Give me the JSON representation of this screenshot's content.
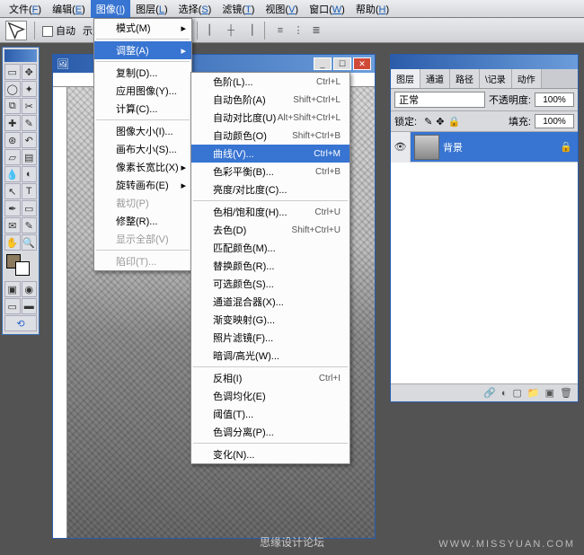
{
  "menubar": {
    "items": [
      {
        "label": "文件",
        "hot": "F"
      },
      {
        "label": "编辑",
        "hot": "E"
      },
      {
        "label": "图像",
        "hot": "I"
      },
      {
        "label": "图层",
        "hot": "L"
      },
      {
        "label": "选择",
        "hot": "S"
      },
      {
        "label": "滤镜",
        "hot": "T"
      },
      {
        "label": "视图",
        "hot": "V"
      },
      {
        "label": "窗口",
        "hot": "W"
      },
      {
        "label": "帮助",
        "hot": "H"
      }
    ],
    "active_index": 2
  },
  "options": {
    "auto_checkbox_label": "自动",
    "show_transform_label": "示定界框"
  },
  "image_menu": {
    "items": [
      {
        "label": "模式(M)",
        "sub": true
      },
      {
        "sep": true
      },
      {
        "label": "调整(A)",
        "sub": true,
        "hi": true
      },
      {
        "sep": true
      },
      {
        "label": "复制(D)...",
        "sub": false
      },
      {
        "label": "应用图像(Y)...",
        "sub": false
      },
      {
        "label": "计算(C)...",
        "sub": false
      },
      {
        "sep": true
      },
      {
        "label": "图像大小(I)...",
        "sub": false
      },
      {
        "label": "画布大小(S)...",
        "sub": false
      },
      {
        "label": "像素长宽比(X)",
        "sub": true
      },
      {
        "label": "旋转画布(E)",
        "sub": true
      },
      {
        "label": "裁切(P)",
        "disabled": true
      },
      {
        "label": "修整(R)...",
        "sub": false
      },
      {
        "label": "显示全部(V)",
        "disabled": true
      },
      {
        "sep": true
      },
      {
        "label": "陷印(T)...",
        "disabled": true
      }
    ]
  },
  "adjust_menu": {
    "items": [
      {
        "label": "色阶(L)...",
        "sc": "Ctrl+L"
      },
      {
        "label": "自动色阶(A)",
        "sc": "Shift+Ctrl+L"
      },
      {
        "label": "自动对比度(U)",
        "sc": "Alt+Shift+Ctrl+L"
      },
      {
        "label": "自动颜色(O)",
        "sc": "Shift+Ctrl+B"
      },
      {
        "label": "曲线(V)...",
        "sc": "Ctrl+M",
        "hi": true
      },
      {
        "label": "色彩平衡(B)...",
        "sc": "Ctrl+B"
      },
      {
        "label": "亮度/对比度(C)..."
      },
      {
        "sep": true
      },
      {
        "label": "色相/饱和度(H)...",
        "sc": "Ctrl+U"
      },
      {
        "label": "去色(D)",
        "sc": "Shift+Ctrl+U"
      },
      {
        "label": "匹配颜色(M)..."
      },
      {
        "label": "替换颜色(R)..."
      },
      {
        "label": "可选颜色(S)..."
      },
      {
        "label": "通道混合器(X)..."
      },
      {
        "label": "渐变映射(G)..."
      },
      {
        "label": "照片滤镜(F)..."
      },
      {
        "label": "暗调/高光(W)..."
      },
      {
        "sep": true
      },
      {
        "label": "反相(I)",
        "sc": "Ctrl+I"
      },
      {
        "label": "色调均化(E)"
      },
      {
        "label": "阈值(T)..."
      },
      {
        "label": "色调分离(P)..."
      },
      {
        "sep": true
      },
      {
        "label": "变化(N)..."
      }
    ]
  },
  "layers": {
    "tabs": [
      "图层",
      "通道",
      "路径",
      "\\记录",
      "动作"
    ],
    "active_tab": 0,
    "mode": "正常",
    "opacity_label": "不透明度:",
    "opacity_value": "100%",
    "lock_label": "锁定:",
    "fill_label": "填充:",
    "fill_value": "100%",
    "items": [
      {
        "name": "背景",
        "locked": true
      }
    ]
  },
  "watermark": "WWW.MISSYUAN.COM",
  "watermark_cn": "思缘设计论坛"
}
